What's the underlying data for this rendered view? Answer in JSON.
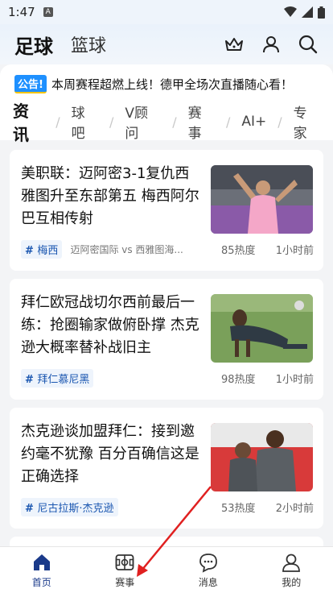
{
  "status_bar": {
    "time": "1:47",
    "notif_icon": "A"
  },
  "header": {
    "sport_tabs": [
      {
        "label": "足球",
        "active": true
      },
      {
        "label": "篮球",
        "active": false
      }
    ],
    "icons": [
      "crown-icon",
      "user-icon",
      "search-icon"
    ]
  },
  "announcement": {
    "badge": "公告!",
    "text": "本周赛程超燃上线！德甲全场次直播随心看！"
  },
  "subtabs": [
    "资讯",
    "球吧",
    "V顾问",
    "赛事",
    "AI+",
    "专家"
  ],
  "articles": [
    {
      "title": "美职联：迈阿密3-1复仇西雅图升至东部第五 梅西阿尔巴互相传射",
      "tag": "梅西",
      "extra": "迈阿密国际 vs 西雅图海...",
      "heat": "85热度",
      "time": "1小时前",
      "image": "messi-celebration-photo"
    },
    {
      "title": "拜仁欧冠战切尔西前最后一练：抢圈输家做俯卧撑 杰克逊大概率替补战旧主",
      "tag": "拜仁慕尼黑",
      "extra": "",
      "heat": "98热度",
      "time": "1小时前",
      "image": "pushup-training-photo"
    },
    {
      "title": "杰克逊谈加盟拜仁：接到邀约毫不犹豫 百分百确信这是正确选择",
      "tag": "尼古拉斯·杰克逊",
      "extra": "",
      "heat": "53热度",
      "time": "2小时前",
      "image": "jackson-training-photo"
    }
  ],
  "bottom_nav": [
    {
      "label": "首页",
      "icon": "home-icon",
      "active": true
    },
    {
      "label": "赛事",
      "icon": "match-icon",
      "active": false
    },
    {
      "label": "消息",
      "icon": "message-icon",
      "active": false
    },
    {
      "label": "我的",
      "icon": "profile-icon",
      "active": false
    }
  ],
  "colors": {
    "accent": "#ff6b3d",
    "brand_blue": "#1a56b0",
    "annotation_arrow": "#e02020"
  }
}
